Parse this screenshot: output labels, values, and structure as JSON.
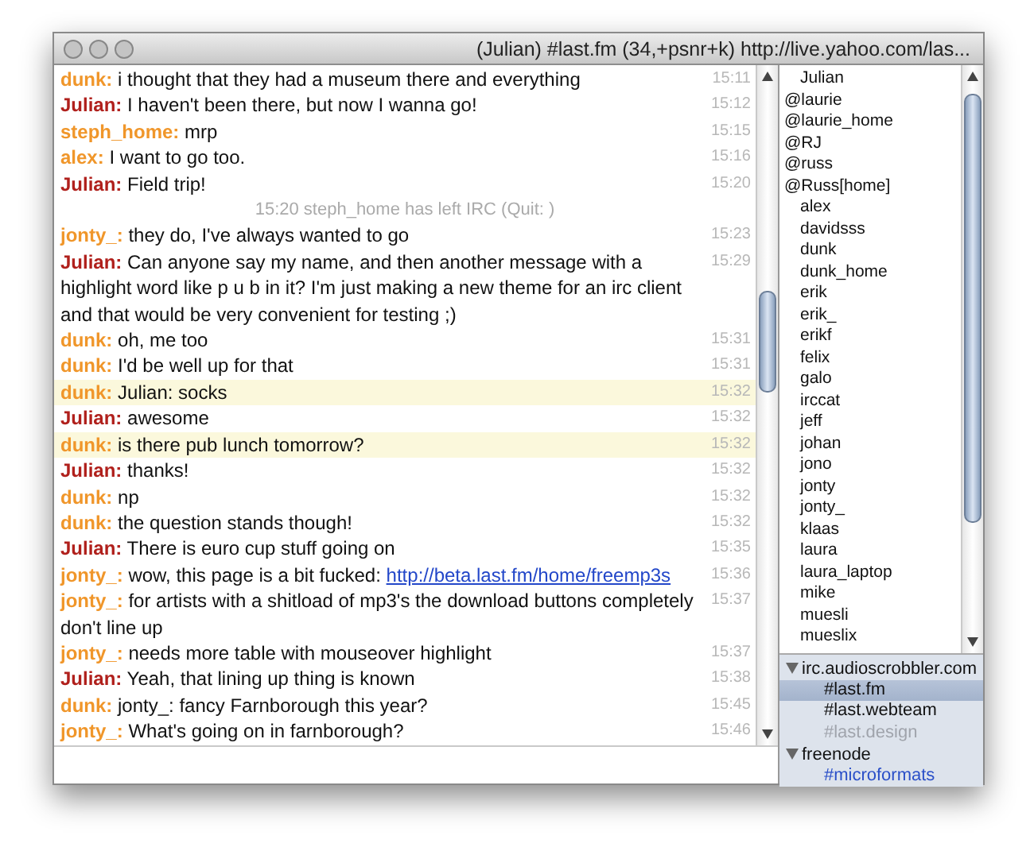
{
  "window": {
    "title": "(Julian) #last.fm (34,+psnr+k) http://live.yahoo.com/las..."
  },
  "messages": [
    {
      "kind": "message",
      "nick": "dunk:",
      "color": "#f0962a",
      "text": "i thought that they had a museum there and everything",
      "time": "15:11",
      "highlighted": false
    },
    {
      "kind": "message",
      "nick": "Julian:",
      "color": "#b0201c",
      "text": "I haven't been there, but now I wanna go!",
      "time": "15:12",
      "highlighted": false
    },
    {
      "kind": "message",
      "nick": "steph_home:",
      "color": "#f0962a",
      "text": "mrp",
      "time": "15:15",
      "highlighted": false
    },
    {
      "kind": "message",
      "nick": "alex:",
      "color": "#f0962a",
      "text": "I want to go too.",
      "time": "15:16",
      "highlighted": false
    },
    {
      "kind": "message",
      "nick": "Julian:",
      "color": "#b0201c",
      "text": "Field trip!",
      "time": "15:20",
      "highlighted": false
    },
    {
      "kind": "event",
      "text": "15:20 steph_home has left IRC (Quit: )"
    },
    {
      "kind": "message",
      "nick": "jonty_:",
      "color": "#f0962a",
      "text": "they do, I've always wanted to go",
      "time": "15:23",
      "highlighted": false
    },
    {
      "kind": "message",
      "nick": "Julian:",
      "color": "#b0201c",
      "text": "Can anyone say my name, and then another message with a highlight word like p u b  in it? I'm just making a new theme for an irc client and that would be very convenient for testing ;)",
      "time": "15:29",
      "highlighted": false
    },
    {
      "kind": "message",
      "nick": "dunk:",
      "color": "#f0962a",
      "text": "oh, me too",
      "time": "15:31",
      "highlighted": false
    },
    {
      "kind": "message",
      "nick": "dunk:",
      "color": "#f0962a",
      "text": "I'd be well up for that",
      "time": "15:31",
      "highlighted": false
    },
    {
      "kind": "message",
      "nick": "dunk:",
      "color": "#f0962a",
      "text": "Julian: socks",
      "time": "15:32",
      "highlighted": true
    },
    {
      "kind": "message",
      "nick": "Julian:",
      "color": "#b0201c",
      "text": "awesome",
      "time": "15:32",
      "highlighted": false
    },
    {
      "kind": "message",
      "nick": "dunk:",
      "color": "#f0962a",
      "text": "is there pub lunch tomorrow?",
      "time": "15:32",
      "highlighted": true
    },
    {
      "kind": "message",
      "nick": "Julian:",
      "color": "#b0201c",
      "text": "thanks!",
      "time": "15:32",
      "highlighted": false
    },
    {
      "kind": "message",
      "nick": "dunk:",
      "color": "#f0962a",
      "text": "np",
      "time": "15:32",
      "highlighted": false
    },
    {
      "kind": "message",
      "nick": "dunk:",
      "color": "#f0962a",
      "text": "the question stands though!",
      "time": "15:32",
      "highlighted": false
    },
    {
      "kind": "message",
      "nick": "Julian:",
      "color": "#b0201c",
      "text": "There is euro cup stuff going on",
      "time": "15:35",
      "highlighted": false
    },
    {
      "kind": "message",
      "nick": "jonty_:",
      "color": "#f0962a",
      "text": "wow, this page is a bit fucked:",
      "link": "http://beta.last.fm/home/freemp3s",
      "time": "15:36",
      "highlighted": false
    },
    {
      "kind": "message",
      "nick": "jonty_:",
      "color": "#f0962a",
      "text": "for artists with a shitload of mp3's the download buttons completely don't line up",
      "time": "15:37",
      "highlighted": false
    },
    {
      "kind": "message",
      "nick": "jonty_:",
      "color": "#f0962a",
      "text": "needs more table with mouseover highlight",
      "time": "15:37",
      "highlighted": false
    },
    {
      "kind": "message",
      "nick": "Julian:",
      "color": "#b0201c",
      "text": "Yeah, that lining up thing is known",
      "time": "15:38",
      "highlighted": false
    },
    {
      "kind": "message",
      "nick": "dunk:",
      "color": "#f0962a",
      "text": "jonty_: fancy Farnborough this year?",
      "time": "15:45",
      "highlighted": false
    },
    {
      "kind": "message",
      "nick": "jonty_:",
      "color": "#f0962a",
      "text": "What's going on in farnborough?",
      "time": "15:46",
      "highlighted": false
    }
  ],
  "users": [
    {
      "name": "Julian",
      "op": false
    },
    {
      "name": "@laurie",
      "op": true
    },
    {
      "name": "@laurie_home",
      "op": true
    },
    {
      "name": "@RJ",
      "op": true
    },
    {
      "name": "@russ",
      "op": true
    },
    {
      "name": "@Russ[home]",
      "op": true
    },
    {
      "name": "alex",
      "op": false
    },
    {
      "name": "davidsss",
      "op": false
    },
    {
      "name": "dunk",
      "op": false
    },
    {
      "name": "dunk_home",
      "op": false
    },
    {
      "name": "erik",
      "op": false
    },
    {
      "name": "erik_",
      "op": false
    },
    {
      "name": "erikf",
      "op": false
    },
    {
      "name": "felix",
      "op": false
    },
    {
      "name": "galo",
      "op": false
    },
    {
      "name": "irccat",
      "op": false
    },
    {
      "name": "jeff",
      "op": false
    },
    {
      "name": "johan",
      "op": false
    },
    {
      "name": "jono",
      "op": false
    },
    {
      "name": "jonty",
      "op": false
    },
    {
      "name": "jonty_",
      "op": false
    },
    {
      "name": "klaas",
      "op": false
    },
    {
      "name": "laura",
      "op": false
    },
    {
      "name": "laura_laptop",
      "op": false
    },
    {
      "name": "mike",
      "op": false
    },
    {
      "name": "muesli",
      "op": false
    },
    {
      "name": "mueslix",
      "op": false
    }
  ],
  "servers": [
    {
      "name": "irc.audioscrobbler.com",
      "expanded": true,
      "children": [
        {
          "name": "#last.fm",
          "selected": true,
          "color": "#111111"
        },
        {
          "name": "#last.webteam",
          "selected": false,
          "color": "#111111"
        },
        {
          "name": "#last.design",
          "selected": false,
          "color": "#a0a4ac"
        }
      ]
    },
    {
      "name": "freenode",
      "expanded": true,
      "children": [
        {
          "name": "#microformats",
          "selected": false,
          "color": "#2a4fc8"
        }
      ]
    }
  ]
}
